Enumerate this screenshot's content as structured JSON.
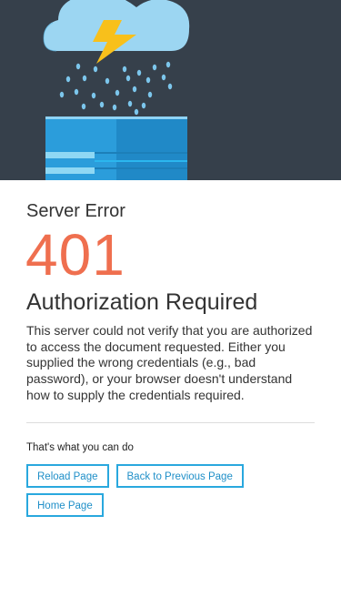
{
  "hero": {
    "background_color": "#36404b",
    "illustration": [
      "cloud-icon",
      "lightning-bolt-icon",
      "rain-drops",
      "server-box"
    ]
  },
  "error": {
    "heading": "Server Error",
    "code": "401",
    "title": "Authorization Required",
    "description": "This server could not verify that you are authorized to access the document requested. Either you supplied the wrong credentials (e.g., bad password), or your browser doesn't understand how to supply the credentials required."
  },
  "actions": {
    "heading": "That's what you can do",
    "buttons": [
      {
        "label": "Reload Page"
      },
      {
        "label": "Back to Previous Page"
      },
      {
        "label": "Home Page"
      }
    ]
  },
  "colors": {
    "accent": "#29a8de",
    "error_code": "#ef6f4f",
    "text": "#333333"
  }
}
